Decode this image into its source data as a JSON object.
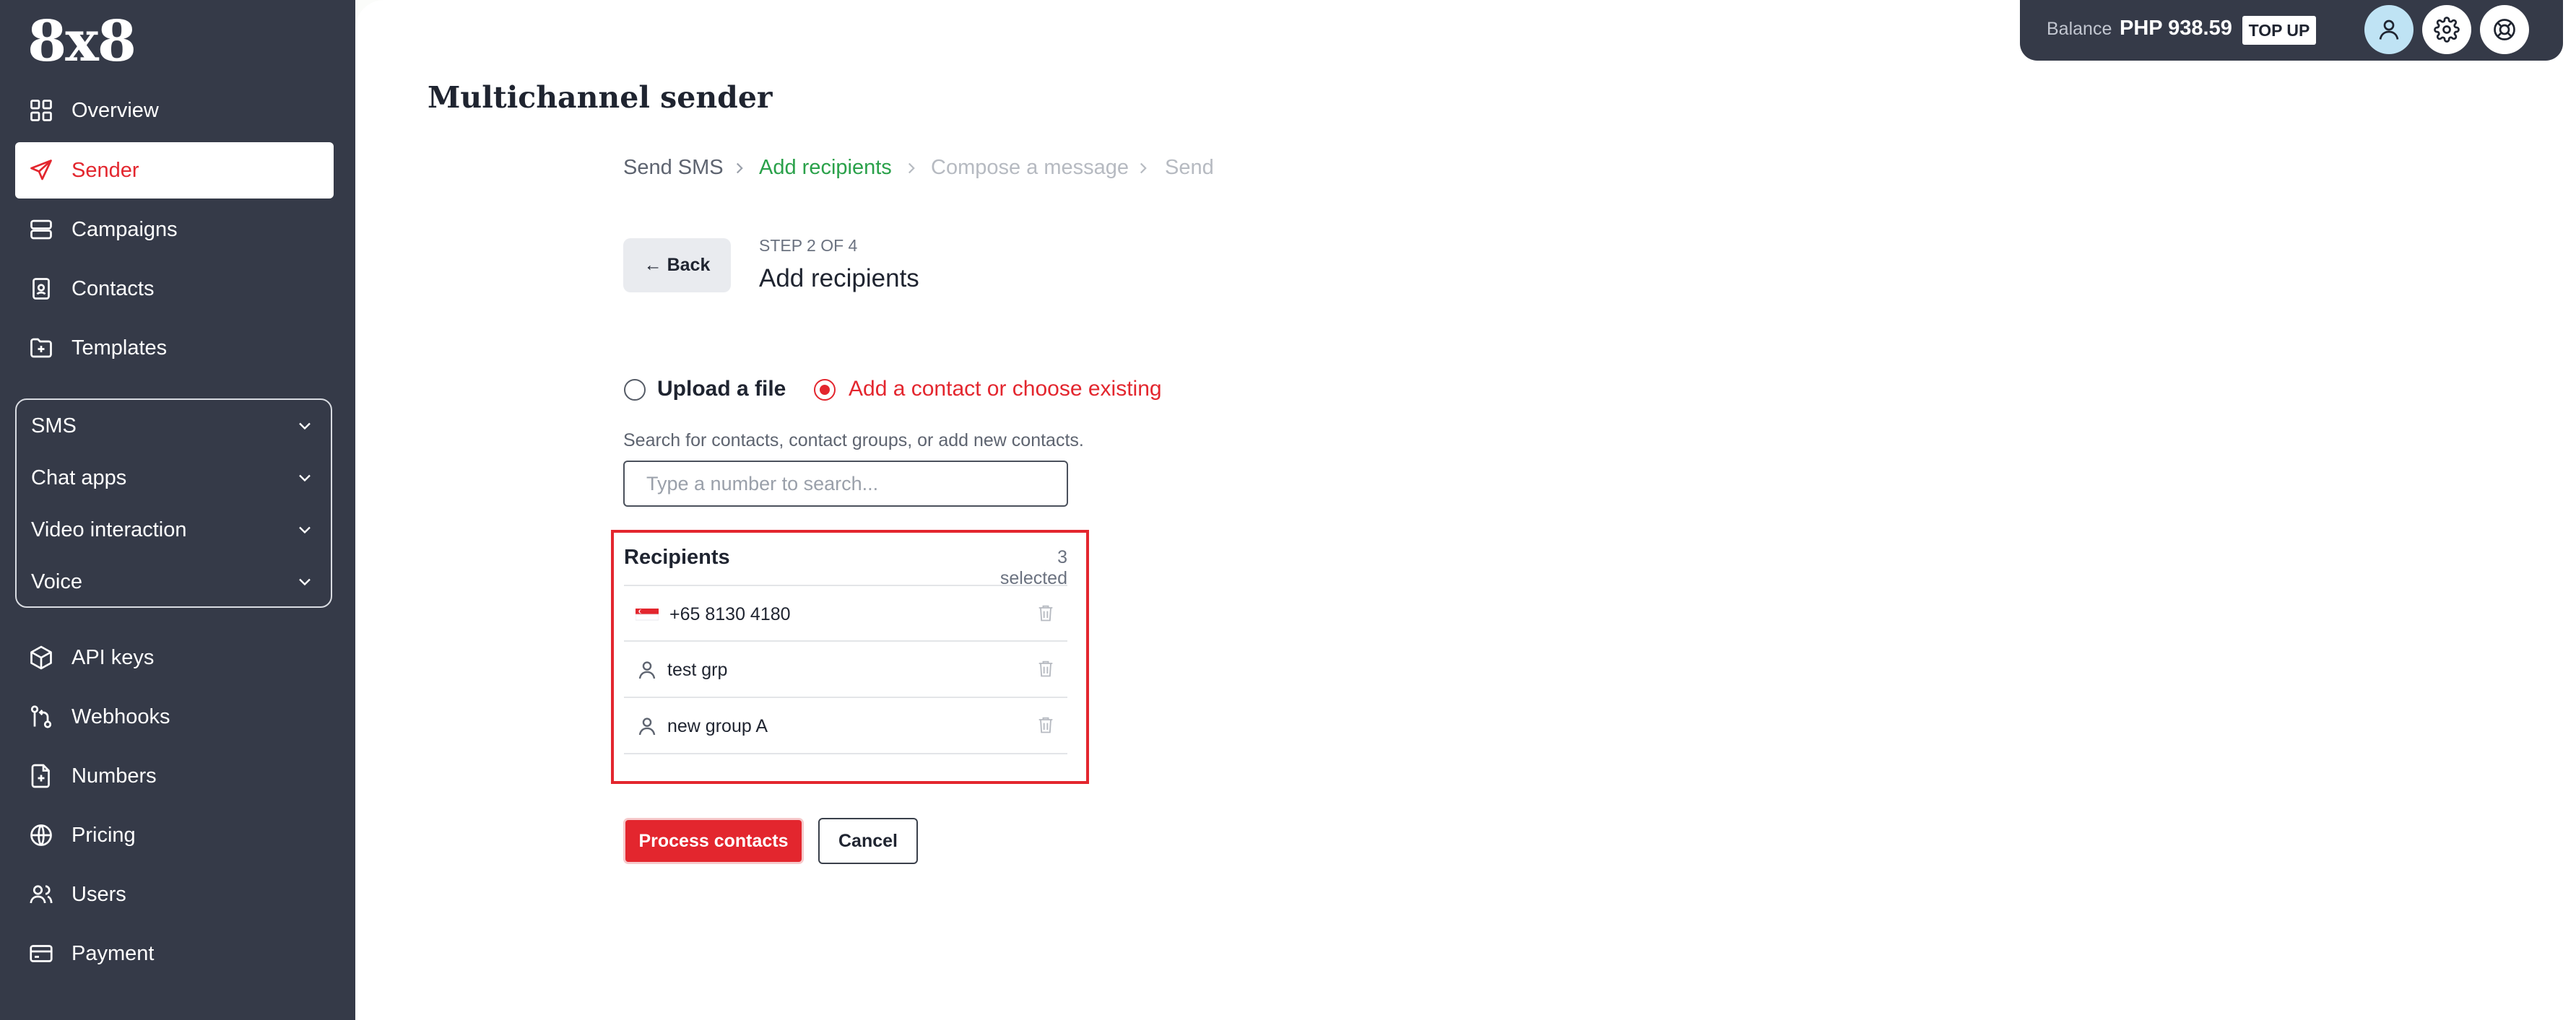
{
  "app": {
    "logo": "8x8"
  },
  "sidebar": {
    "primary": [
      {
        "label": "Overview",
        "icon": "grid-icon",
        "active": false
      },
      {
        "label": "Sender",
        "icon": "send-icon",
        "active": true
      },
      {
        "label": "Campaigns",
        "icon": "campaigns-icon",
        "active": false
      },
      {
        "label": "Contacts",
        "icon": "contacts-icon",
        "active": false
      },
      {
        "label": "Templates",
        "icon": "templates-icon",
        "active": false
      }
    ],
    "groups": [
      {
        "label": "SMS"
      },
      {
        "label": "Chat apps"
      },
      {
        "label": "Video interaction"
      },
      {
        "label": "Voice"
      }
    ],
    "secondary": [
      {
        "label": "API keys",
        "icon": "cube-icon"
      },
      {
        "label": "Webhooks",
        "icon": "webhook-icon"
      },
      {
        "label": "Numbers",
        "icon": "numbers-icon"
      },
      {
        "label": "Pricing",
        "icon": "globe-icon"
      },
      {
        "label": "Users",
        "icon": "users-icon"
      },
      {
        "label": "Payment",
        "icon": "credit-card-icon"
      }
    ]
  },
  "topbar": {
    "balance_label": "Balance",
    "balance_value": "PHP 938.59",
    "topup_label": "TOP UP"
  },
  "page": {
    "title": "Multichannel sender"
  },
  "breadcrumb": [
    {
      "label": "Send SMS",
      "state": "done"
    },
    {
      "label": "Add recipients",
      "state": "current"
    },
    {
      "label": "Compose a message",
      "state": "upcoming"
    },
    {
      "label": "Send",
      "state": "upcoming"
    }
  ],
  "step": {
    "back_label": "Back",
    "counter": "STEP 2 OF 4",
    "title": "Add recipients"
  },
  "source_options": [
    {
      "label": "Upload a file",
      "selected": false
    },
    {
      "label": "Add a contact or choose existing",
      "selected": true
    }
  ],
  "search": {
    "hint": "Search for contacts, contact groups, or add new contacts.",
    "placeholder": "Type a number to search..."
  },
  "recipients": {
    "title": "Recipients",
    "count_label": "3 selected",
    "items": [
      {
        "type": "number",
        "icon": "singapore-flag-icon",
        "label": "+65 8130 4180"
      },
      {
        "type": "group",
        "icon": "person-icon",
        "label": "test grp"
      },
      {
        "type": "group",
        "icon": "person-icon",
        "label": "new group A"
      }
    ]
  },
  "actions": {
    "process_label": "Process contacts",
    "cancel_label": "Cancel"
  },
  "colors": {
    "sidebar_bg": "#353a48",
    "accent_red": "#e3262e",
    "accent_green": "#2aa14a",
    "muted": "#b6bac1"
  }
}
